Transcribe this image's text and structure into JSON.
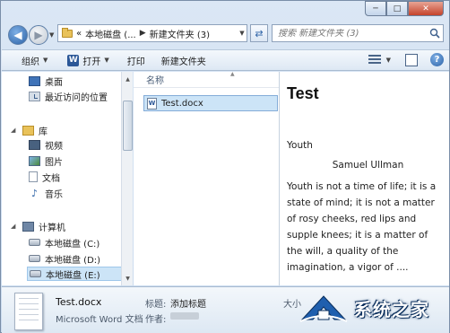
{
  "window": {
    "caption": {
      "minimize": "─",
      "maximize": "□",
      "close": "✕"
    }
  },
  "address": {
    "chevrons": "«",
    "crumbs": [
      "本地磁盘 (...",
      "新建文件夹 (3)"
    ],
    "separator": "▶"
  },
  "search": {
    "placeholder": "搜索 新建文件夹 (3)"
  },
  "commandbar": {
    "organize": "组织",
    "open": "打开",
    "print": "打印",
    "new_folder": "新建文件夹"
  },
  "nav": {
    "items": [
      {
        "label": "桌面"
      },
      {
        "label": "最近访问的位置"
      },
      {
        "label": "库"
      },
      {
        "label": "视频"
      },
      {
        "label": "图片"
      },
      {
        "label": "文档"
      },
      {
        "label": "音乐"
      },
      {
        "label": "计算机"
      },
      {
        "label": "本地磁盘 (C:)"
      },
      {
        "label": "本地磁盘 (D:)"
      },
      {
        "label": "本地磁盘 (E:)"
      }
    ]
  },
  "files": {
    "column_name": "名称",
    "items": [
      {
        "name": "Test.docx",
        "selected": true
      }
    ]
  },
  "preview": {
    "title": "Test",
    "heading": "Youth",
    "author": "Samuel Ullman",
    "body": "Youth is not a time of life; it is a state of mind; it is not a matter of rosy cheeks, red lips and supple knees; it is a matter of the will, a quality of the imagination, a vigor of ...."
  },
  "details": {
    "file_name": "Test.docx",
    "file_type": "Microsoft Word 文档",
    "title_label": "标题:",
    "title_value": "添加标题",
    "author_label": "作者:",
    "size_label": "大小"
  },
  "watermark": {
    "text": "系统之家"
  }
}
